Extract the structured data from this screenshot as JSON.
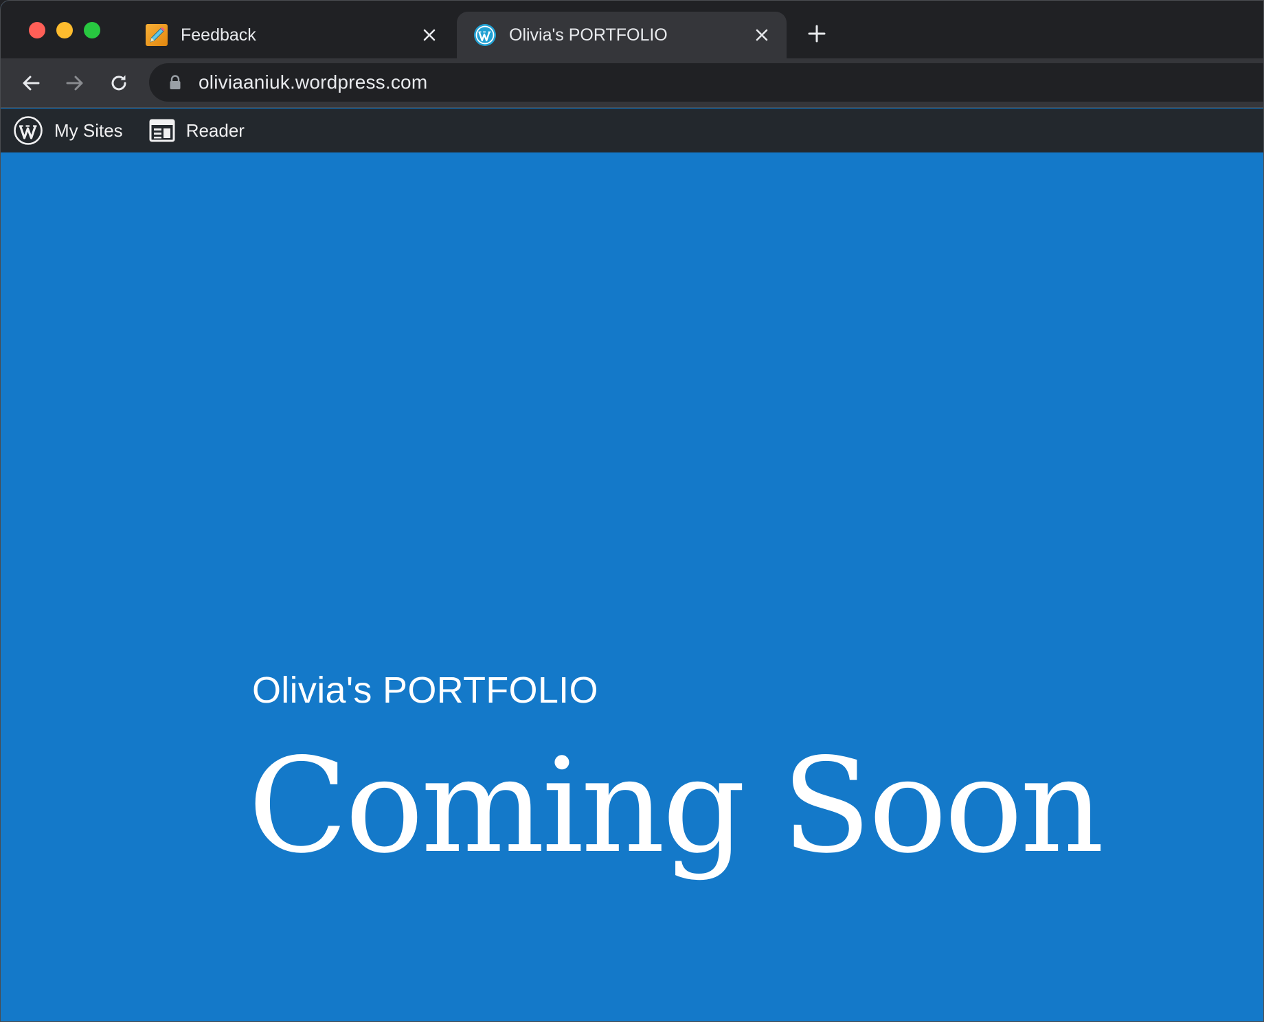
{
  "browser": {
    "tabs": [
      {
        "title": "Feedback",
        "icon": "pencil-note-icon",
        "active": false
      },
      {
        "title": "Olivia's PORTFOLIO",
        "icon": "wordpress-icon",
        "active": true
      }
    ],
    "address_bar": {
      "url": "oliviaaniuk.wordpress.com",
      "secure": true
    }
  },
  "admin_bar": {
    "my_sites_label": "My Sites",
    "reader_label": "Reader"
  },
  "page": {
    "site_title": "Olivia's PORTFOLIO",
    "headline": "Coming Soon",
    "background_color": "#1479c9"
  }
}
